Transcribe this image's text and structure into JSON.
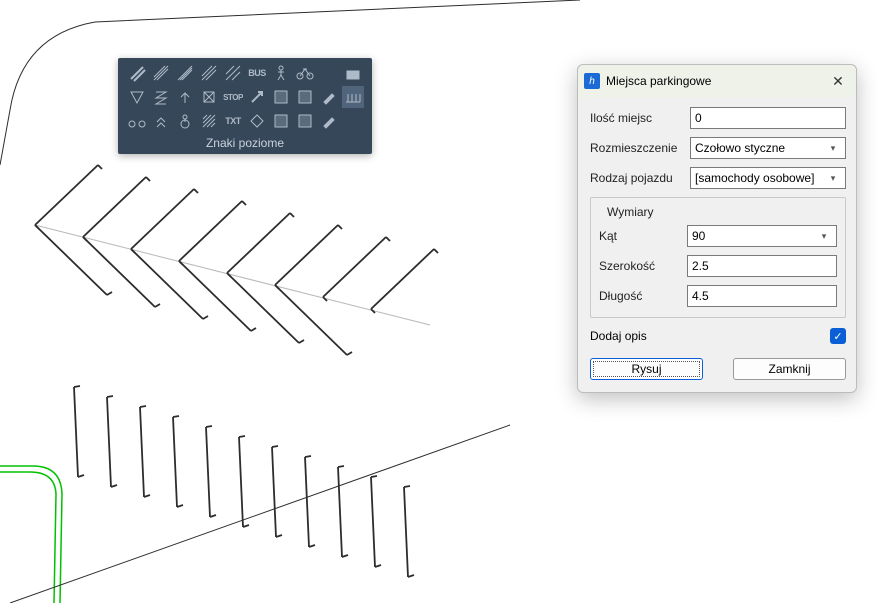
{
  "toolbox": {
    "title": "Znaki poziome",
    "row1_text": [
      "",
      "",
      "",
      "",
      "",
      "BUS",
      "",
      "",
      "",
      ""
    ],
    "row3_text": [
      "",
      "",
      "",
      "",
      "TXT",
      "",
      "",
      "",
      "",
      ""
    ]
  },
  "dialog": {
    "title": "Miejsca parkingowe",
    "fields": {
      "count_label": "Ilość miejsc",
      "count_value": "0",
      "arrangement_label": "Rozmieszczenie",
      "arrangement_value": "Czołowo styczne",
      "vehicle_label": "Rodzaj pojazdu",
      "vehicle_value": "[samochody osobowe]"
    },
    "dimensions": {
      "legend": "Wymiary",
      "angle_label": "Kąt",
      "angle_value": "90",
      "width_label": "Szerokość",
      "width_value": "2.5",
      "length_label": "Długość",
      "length_value": "4.5"
    },
    "add_description_label": "Dodaj opis",
    "buttons": {
      "draw": "Rysuj",
      "close": "Zamknij"
    }
  }
}
